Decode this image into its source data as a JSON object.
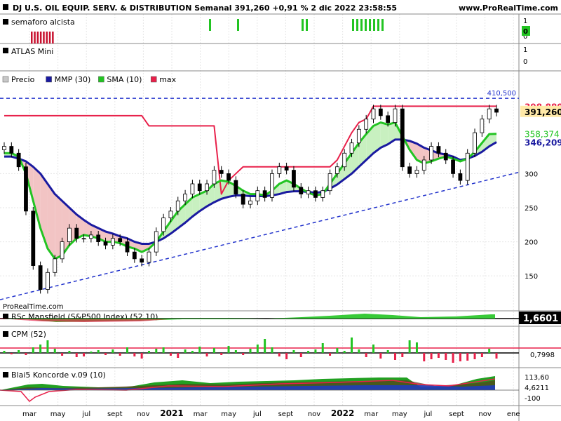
{
  "header": {
    "title": "DJ U.S. OIL EQUIP. SERV. & DISTRIBUTION Semanal 391,260 +0,91 % 2 dic 2022 23:58:55",
    "brand": "www.ProRealTime.com",
    "watermark": "ProRealTime.com"
  },
  "panels": {
    "semaforo": {
      "label": "semaforo alcista",
      "axis_ticks": [
        "1",
        "0"
      ],
      "value": "0"
    },
    "atlas": {
      "label": "ATLAS Mini",
      "axis_ticks": [
        "1",
        "0"
      ]
    },
    "price": {
      "legend": [
        {
          "label": "Precio",
          "color": "#c8c8c8"
        },
        {
          "label": "MMP (30)",
          "color": "#1a1aa0"
        },
        {
          "label": "SMA (10)",
          "color": "#22c422"
        },
        {
          "label": "max",
          "color": "#e8204a"
        }
      ]
    },
    "rsc": {
      "label": "RSc Mansfield (S&P500 Index) (52 10)",
      "value": "1,6601"
    },
    "cpm": {
      "label": "CPM (52)",
      "value": "0,7998"
    },
    "koncorde": {
      "label": "Blai5 Koncorde v.09 (10)",
      "values": [
        "113,60",
        "4,6211",
        "-100"
      ]
    }
  },
  "colors": {
    "up": "#22c422",
    "down": "#e8204a",
    "mmp": "#1a1aa0",
    "max": "#e8204a",
    "trend": "#2233cc"
  },
  "chart_data": {
    "type": "candlestick",
    "title": "DJ U.S. OIL EQUIP. SERV. & DISTRIBUTION Semanal",
    "x_ticks": [
      "mar",
      "may",
      "jul",
      "sept",
      "nov",
      "2021",
      "mar",
      "may",
      "jul",
      "sept",
      "nov",
      "2022",
      "mar",
      "may",
      "jul",
      "sept",
      "nov",
      "ene"
    ],
    "y_ticks": [
      150,
      200,
      250,
      300
    ],
    "ylim": [
      110,
      425
    ],
    "value_labels": {
      "resistance": "410,500",
      "max": "398,880",
      "price": "391,260",
      "sma": "358,374",
      "mmp": "346,209"
    },
    "series": [
      {
        "name": "Precio",
        "values": [
          340,
          330,
          310,
          245,
          165,
          130,
          155,
          175,
          200,
          220,
          205,
          205,
          210,
          200,
          195,
          205,
          200,
          185,
          175,
          170,
          185,
          215,
          235,
          245,
          260,
          270,
          285,
          275,
          285,
          305,
          300,
          290,
          270,
          255,
          260,
          275,
          265,
          300,
          310,
          305,
          280,
          270,
          275,
          265,
          275,
          300,
          310,
          330,
          345,
          365,
          380,
          395,
          385,
          375,
          395,
          310,
          300,
          305,
          320,
          340,
          330,
          320,
          300,
          290,
          330,
          360,
          380,
          395,
          390
        ]
      },
      {
        "name": "max",
        "values": [
          385,
          385,
          385,
          385,
          385,
          385,
          385,
          385,
          385,
          385,
          385,
          385,
          385,
          385,
          385,
          385,
          385,
          385,
          385,
          385,
          370,
          370,
          370,
          370,
          370,
          370,
          370,
          370,
          370,
          370,
          270,
          290,
          300,
          310,
          310,
          310,
          310,
          310,
          310,
          310,
          310,
          310,
          310,
          310,
          310,
          310,
          320,
          340,
          360,
          375,
          380,
          398.9,
          398.9,
          398.9,
          398.9,
          398.9,
          398.9,
          398.9,
          398.9,
          398.9,
          398.9,
          398.9,
          398.9,
          398.9,
          398.9,
          398.9,
          398.9,
          398.9,
          398.9
        ]
      },
      {
        "name": "SMA (10)",
        "values": [
          330,
          330,
          325,
          300,
          260,
          220,
          190,
          175,
          180,
          195,
          205,
          210,
          208,
          205,
          200,
          200,
          198,
          193,
          190,
          185,
          190,
          200,
          215,
          230,
          245,
          255,
          265,
          270,
          275,
          285,
          290,
          288,
          282,
          275,
          270,
          270,
          268,
          275,
          285,
          290,
          285,
          278,
          272,
          268,
          270,
          285,
          300,
          315,
          330,
          345,
          358,
          370,
          375,
          372,
          375,
          355,
          335,
          320,
          315,
          318,
          322,
          325,
          322,
          318,
          322,
          332,
          345,
          358,
          358.4
        ]
      },
      {
        "name": "MMP (30)",
        "values": [
          325,
          325,
          322,
          318,
          310,
          300,
          285,
          270,
          260,
          250,
          240,
          232,
          225,
          220,
          215,
          212,
          208,
          205,
          200,
          197,
          197,
          200,
          205,
          212,
          220,
          228,
          237,
          245,
          252,
          258,
          263,
          266,
          268,
          268,
          267,
          267,
          267,
          268,
          270,
          273,
          274,
          274,
          273,
          272,
          273,
          278,
          284,
          292,
          300,
          310,
          320,
          330,
          338,
          343,
          350,
          350,
          348,
          344,
          338,
          334,
          330,
          328,
          325,
          320,
          322,
          326,
          332,
          340,
          346.2
        ]
      }
    ]
  }
}
